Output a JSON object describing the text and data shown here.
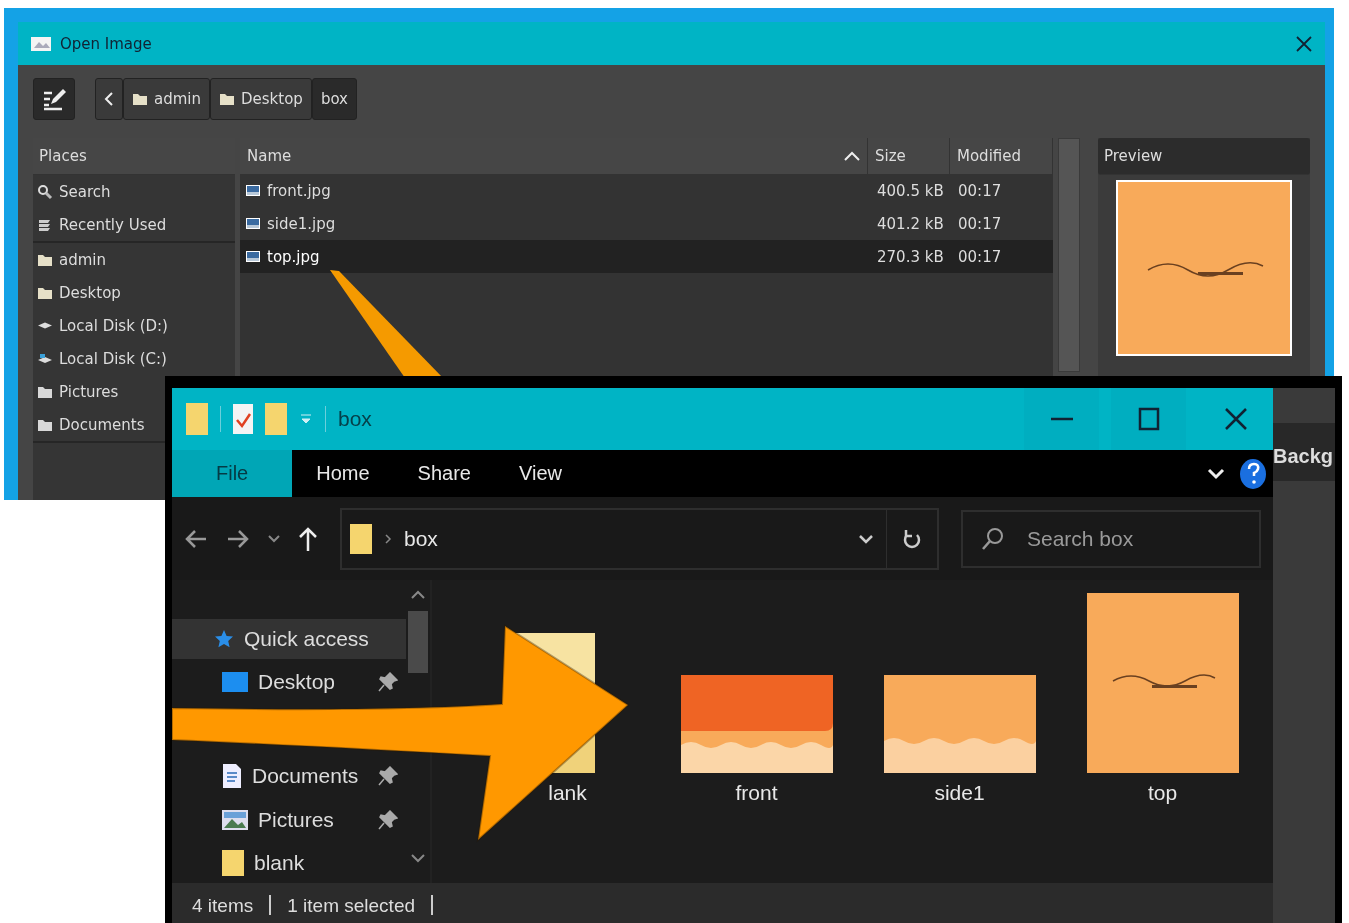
{
  "open_dialog": {
    "title": "Open Image",
    "path_buttons": [
      {
        "label": "admin",
        "kind": "folder",
        "selected": false
      },
      {
        "label": "Desktop",
        "kind": "folder",
        "selected": false
      },
      {
        "label": "box",
        "kind": "plain",
        "selected": true
      }
    ],
    "places": {
      "header": "Places",
      "groups": [
        [
          {
            "label": "Search",
            "kind": "search"
          },
          {
            "label": "Recently Used",
            "kind": "recent"
          }
        ],
        [
          {
            "label": "admin",
            "kind": "folder"
          },
          {
            "label": "Desktop",
            "kind": "folder"
          },
          {
            "label": "Local Disk (D:)",
            "kind": "drive"
          },
          {
            "label": "Local Disk (C:)",
            "kind": "system-drive"
          },
          {
            "label": "Pictures",
            "kind": "folder-grey"
          },
          {
            "label": "Documents",
            "kind": "folder-grey"
          }
        ]
      ]
    },
    "columns": [
      {
        "label": "Name",
        "sorted": true
      },
      {
        "label": "Size",
        "sorted": false
      },
      {
        "label": "Modified",
        "sorted": false
      }
    ],
    "rows": [
      {
        "name": "front.jpg",
        "size": "400.5 kB",
        "modified": "00:17",
        "selected": false
      },
      {
        "name": "side1.jpg",
        "size": "401.2 kB",
        "modified": "00:17",
        "selected": false
      },
      {
        "name": "top.jpg",
        "size": "270.3 kB",
        "modified": "00:17",
        "selected": true
      }
    ],
    "preview": {
      "header": "Preview"
    },
    "backdrop_label": "Backg"
  },
  "explorer": {
    "title": "box",
    "ribbon_tabs": [
      {
        "label": "File",
        "selected": true
      },
      {
        "label": "Home",
        "selected": false
      },
      {
        "label": "Share",
        "selected": false
      },
      {
        "label": "View",
        "selected": false
      }
    ],
    "address": "box",
    "search": {
      "placeholder": "Search box"
    },
    "nav": [
      {
        "label": "Quick access",
        "kind": "star",
        "selected": true,
        "pinned": false
      },
      {
        "label": "Desktop",
        "kind": "desktop",
        "selected": false,
        "pinned": true
      },
      {
        "label": "Documents",
        "kind": "documents",
        "selected": false,
        "pinned": true
      },
      {
        "label": "Pictures",
        "kind": "pictures",
        "selected": false,
        "pinned": true
      },
      {
        "label": "blank",
        "kind": "folder",
        "selected": false,
        "pinned": false
      }
    ],
    "items": [
      {
        "label": "lank",
        "kind": "folder"
      },
      {
        "label": "front",
        "kind": "front"
      },
      {
        "label": "side1",
        "kind": "side"
      },
      {
        "label": "top",
        "kind": "top"
      }
    ],
    "status": [
      "4 items",
      "1 item selected"
    ]
  }
}
